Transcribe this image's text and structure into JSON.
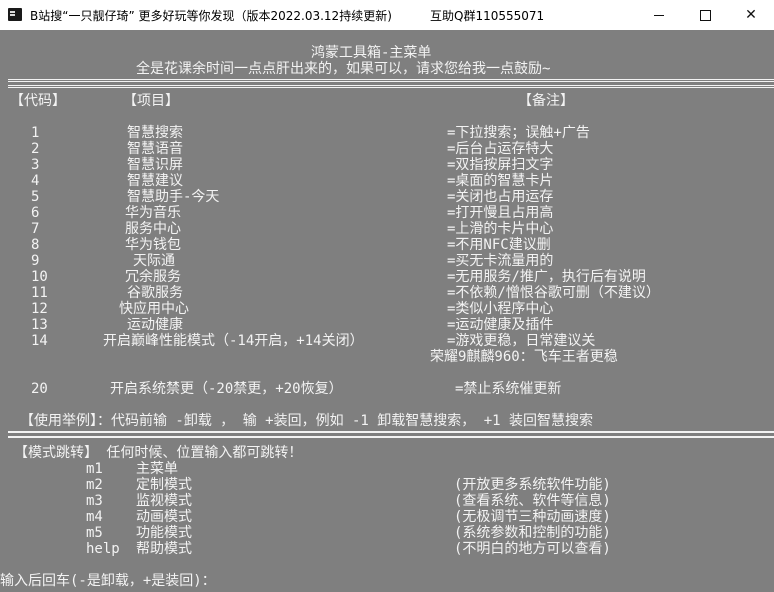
{
  "window": {
    "title": "B站搜“一只靓仔琦” 更多好玩等你发现（版本2022.03.12持续更新)",
    "qq_group": "互助Q群110555071",
    "controls": {
      "minimize": "—",
      "maximize": "☐",
      "close": "✕"
    }
  },
  "header": {
    "title": "鸿蒙工具箱-主菜单",
    "subtitle": "全是花课余时间一点点肝出来的，如果可以，请求您给我一点鼓励~"
  },
  "columns": {
    "code": "【代码】",
    "item": "【项目】",
    "note": "【备注】"
  },
  "menu": [
    {
      "code": "1",
      "item": "智慧搜索",
      "note": "=下拉搜索；误触+广告"
    },
    {
      "code": "2",
      "item": "智慧语音",
      "note": "=后台占运存特大"
    },
    {
      "code": "3",
      "item": "智慧识屏",
      "note": "=双指按屏扫文字"
    },
    {
      "code": "4",
      "item": "智慧建议",
      "note": "=桌面的智慧卡片"
    },
    {
      "code": "5",
      "item": "智慧助手-今天",
      "note": "=关闭也占用运存"
    },
    {
      "code": "6",
      "item": "华为音乐",
      "note": "=打开慢且占用高"
    },
    {
      "code": "7",
      "item": "服务中心",
      "note": "=上滑的卡片中心"
    },
    {
      "code": "8",
      "item": "华为钱包",
      "note": "=不用NFC建议删"
    },
    {
      "code": "9",
      "item": "天际通",
      "note": "=买无卡流量用的"
    },
    {
      "code": "10",
      "item": "冗余服务",
      "note": "=无用服务/推广，执行后有说明"
    },
    {
      "code": "11",
      "item": "谷歌服务",
      "note": "=不依赖/憎恨谷歌可删（不建议）"
    },
    {
      "code": "12",
      "item": "快应用中心",
      "note": "=类似小程序中心"
    },
    {
      "code": "13",
      "item": "运动健康",
      "note": "=运动健康及插件"
    },
    {
      "code": "14",
      "item": "开启巅峰性能模式（-14开启，+14关闭）",
      "note": "=游戏更稳，日常建议关"
    }
  ],
  "menu_extra_note": "荣耀9麒麟960：飞车王者更稳",
  "menu_20": {
    "code": "20",
    "item": "开启系统禁更（-20禁更，+20恢复）",
    "note": "=禁止系统催更新"
  },
  "usage": "【使用举例】：代码前输 -卸载 ， 输 +装回，例如 -1 卸载智慧搜索， +1 装回智慧搜索",
  "modes": {
    "heading": "【模式跳转】 任何时候、位置输入都可跳转！",
    "items": [
      {
        "key": "m1",
        "name": "主菜单",
        "desc": ""
      },
      {
        "key": "m2",
        "name": "定制模式",
        "desc": "(开放更多系统软件功能)"
      },
      {
        "key": "m3",
        "name": "监视模式",
        "desc": "(查看系统、软件等信息)"
      },
      {
        "key": "m4",
        "name": "动画模式",
        "desc": "(无极调节三种动画速度)"
      },
      {
        "key": "m5",
        "name": "功能模式",
        "desc": "(系统参数和控制的功能)"
      },
      {
        "key": "help",
        "name": "帮助模式",
        "desc": "(不明白的地方可以查看)"
      }
    ]
  },
  "prompt": "输入后回车(-是卸载，+是装回)："
}
